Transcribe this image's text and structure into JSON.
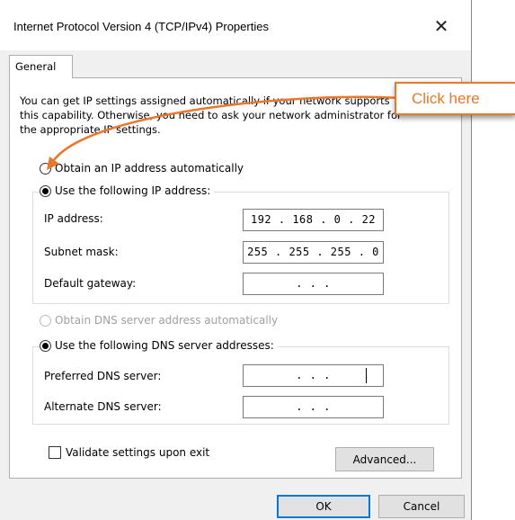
{
  "window": {
    "title": "Internet Protocol Version 4 (TCP/IPv4) Properties",
    "close_glyph": "✕"
  },
  "tabs": [
    {
      "label": "General",
      "selected": true
    }
  ],
  "description": "You can get IP settings assigned automatically if your network supports this capability. Otherwise, you need to ask your network administrator for the appropriate IP settings.",
  "ip": {
    "auto_label": "Obtain an IP address automatically",
    "manual_label": "Use the following IP address:",
    "selected": "manual",
    "fields": [
      {
        "label": "IP address:",
        "value": "192 . 168 .  0  . 22"
      },
      {
        "label": "Subnet mask:",
        "value": "255 . 255 . 255 .  0"
      },
      {
        "label": "Default gateway:",
        "value": " .  .  ."
      }
    ]
  },
  "dns": {
    "auto_label": "Obtain DNS server address automatically",
    "manual_label": "Use the following DNS server addresses:",
    "selected": "manual",
    "auto_disabled": true,
    "fields": [
      {
        "label": "Preferred DNS server:",
        "value": " .  .  ."
      },
      {
        "label": "Alternate DNS server:",
        "value": " .  .  ."
      }
    ]
  },
  "validate_label": "Validate settings upon exit",
  "validate_checked": false,
  "buttons": {
    "advanced": "Advanced...",
    "ok": "OK",
    "cancel": "Cancel"
  },
  "annotation": {
    "text": "Click here",
    "color": "#e8782c"
  }
}
